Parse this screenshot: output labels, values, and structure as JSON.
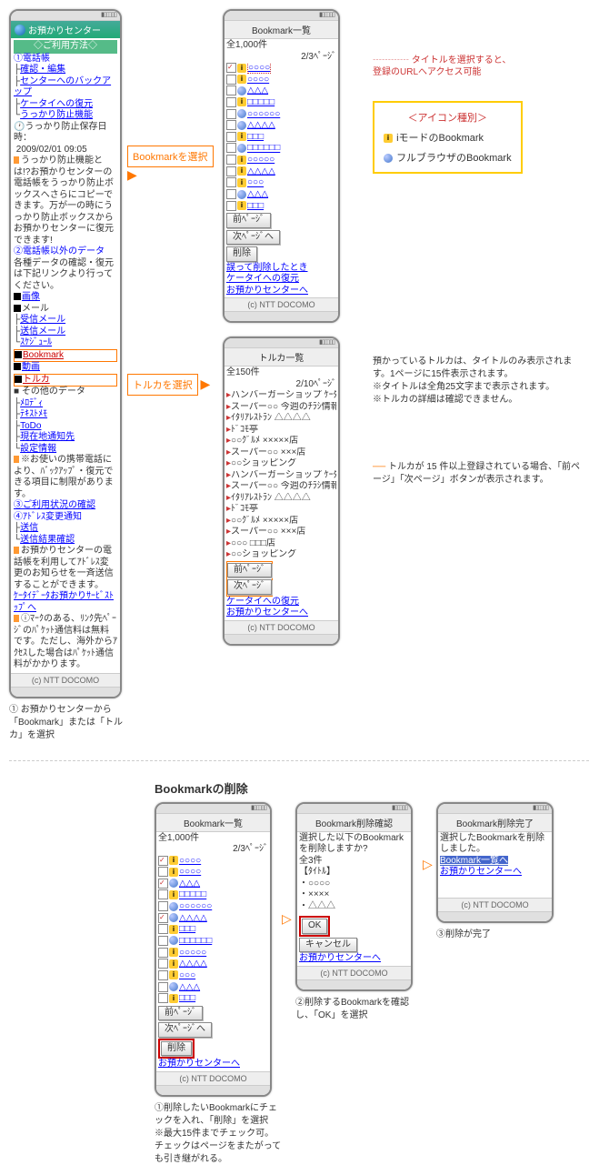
{
  "phone1": {
    "title": "お預かりセンター",
    "usage_header": "◇ご利用方法◇",
    "sec1_title": "①電話帳",
    "links1": [
      "確認・編集",
      "センターへのバックアップ",
      "ケータイへの復元",
      "うっかり防止機能"
    ],
    "clock_label": "うっかり防止保存日時：",
    "clock_time": "2009/02/01 09:05",
    "body1": "うっかり防止機能とは!?お預かりセンターの電話帳をうっかり防止ボックスへさらにコピーできます。万が一の時にうっかり防止ボックスからお預かりセンターに復元できます!",
    "sec2_title": "②電話帳以外のデータ",
    "body2": "各種データの確認・復元は下記リンクより行ってください。",
    "items2": [
      "画像",
      "メール",
      "受信メール",
      "送信メール",
      "ｽｹｼﾞｭｰﾙ",
      "Bookmark",
      "動画",
      "トルカ"
    ],
    "other_title": "■ その他のデータ",
    "items3": [
      "ﾒﾛﾃﾞｨ",
      "ﾃｷｽﾄﾒﾓ",
      "ToDo",
      "現在地通知先",
      "設定情報"
    ],
    "body3": "※お使いの携帯電話により、ﾊﾞｯｸｱｯﾌﾟ・復元できる項目に制限があります。",
    "sec3_title": "③ご利用状況の確認",
    "sec4_title": "④ｱﾄﾞﾚｽ変更通知",
    "links4": [
      "送信",
      "送信結果確認"
    ],
    "body4": "お預かりセンターの電話帳を利用してｱﾄﾞﾚｽ変更のお知らせを一斉送信することができます。",
    "link5": "ｹｰﾀｲﾃﾞｰﾀお預かりｻｰﾋﾞｽﾄｯﾌﾟへ",
    "body5": "ⓘﾏｰｸのある、ﾘﾝｸ先ﾍﾟｰｼﾞのﾊﾟｹｯﾄ通信料は無料です。ただし、海外からｱｸｾｽした場合はﾊﾟｹｯﾄ通信料がかかります。",
    "footer": "(c) NTT DOCOMO"
  },
  "cap1": "① お預かりセンターから「Bookmark」または「トルカ」を選択",
  "callout_bm": "Bookmarkを選択",
  "callout_tr": "トルカを選択",
  "phone2": {
    "title": "Bookmark一覧",
    "count": "全1,000件",
    "page": "2/3ﾍﾟｰｼﾞ",
    "items": [
      {
        "i": "i",
        "c": true,
        "t": "○○○○",
        "hl": true
      },
      {
        "i": "i",
        "t": "○○○○"
      },
      {
        "i": "g",
        "t": "△△△"
      },
      {
        "i": "i",
        "t": "□□□□□"
      },
      {
        "i": "g",
        "t": "○○○○○○"
      },
      {
        "i": "g",
        "t": "△△△△"
      },
      {
        "i": "i",
        "t": "□□□"
      },
      {
        "i": "g",
        "t": "□□□□□□"
      },
      {
        "i": "i",
        "t": "○○○○○"
      },
      {
        "i": "i",
        "t": "△△△△"
      },
      {
        "i": "i",
        "t": "○○○"
      },
      {
        "i": "g",
        "t": "△△△"
      },
      {
        "i": "i",
        "t": "□□□"
      }
    ],
    "prev": "前ﾍﾟｰｼﾞ",
    "next": "次ﾍﾟｰｼﾞへ",
    "del": "削除",
    "links": [
      "誤って削除したとき",
      "ケータイへの復元",
      "お預かりセンターへ"
    ],
    "footer": "(c) NTT DOCOMO"
  },
  "annot_bm1": "タイトルを選択すると、",
  "annot_bm2": "登録のURLへアクセス可能",
  "legend": {
    "title": "＜アイコン種別＞",
    "i1": "iモードのBookmark",
    "i2": "フルブラウザのBookmark"
  },
  "phone3": {
    "title": "トルカ一覧",
    "count": "全150件",
    "page": "2/10ﾍﾟｰｼﾞ",
    "items": [
      "ハンバーガーショップ ｹｰﾀｲｸｰﾎﾟﾝ",
      "スーパー○○ 今週のﾁﾗｼ情報",
      "ｲﾀﾘｱﾚｽﾄﾗﾝ △△△△",
      "ﾄﾞｺﾓ亭",
      "○○ｸﾞﾙﾒ ×××××店",
      "スーパー○○ ×××店",
      "○○ショッピング",
      "ハンバーガーショップ ｹｰﾀｲｸｰﾎﾟﾝ",
      "スーパー○○ 今週のﾁﾗｼ情報",
      "ｲﾀﾘｱﾚｽﾄﾗﾝ △△△△",
      "ﾄﾞｺﾓ亭",
      "○○ｸﾞﾙﾒ ×××××店",
      "スーパー○○ ×××店",
      "○○○ □□□店",
      "○○ショッピング"
    ],
    "prev": "前ﾍﾟｰｼﾞ",
    "next": "次ﾍﾟｰｼﾞ",
    "links": [
      "ケータイへの復元",
      "お預かりセンターへ"
    ],
    "footer": "(c) NTT DOCOMO"
  },
  "note_tr1": "預かっているトルカは、タイトルのみ表示されます。1ページに15件表示されます。",
  "note_tr2": "※タイトルは全角25文字まで表示されます。",
  "note_tr3": "※トルカの詳細は確認できません。",
  "note_tr4": "トルカが 15 件以上登録されている場合、「前ページ」「次ページ」ボタンが表示されます。",
  "section2_title": "Bookmarkの削除",
  "phone4": {
    "title": "Bookmark一覧",
    "count": "全1,000件",
    "page": "2/3ﾍﾟｰｼﾞ",
    "del": "削除",
    "link": "お預かりセンターへ",
    "footer": "(c) NTT DOCOMO"
  },
  "cap4a": "①削除したいBookmarkにチェックを入れ、「削除」を選択",
  "cap4b": "※最大15件までチェック可。チェックはページをまたがっても引き継がれる。",
  "phone5": {
    "title": "Bookmark削除確認",
    "msg": "選択した以下のBookmarkを削除しますか?",
    "count": "全3件",
    "label": "【ﾀｲﾄﾙ】",
    "items": [
      "・○○○○",
      "・××××",
      "・△△△"
    ],
    "ok": "OK",
    "cancel": "キャンセル",
    "link": "お預かりセンターへ",
    "footer": "(c) NTT DOCOMO"
  },
  "cap5": "②削除するBookmarkを確認し、「OK」を選択",
  "phone6": {
    "title": "Bookmark削除完了",
    "msg": "選択したBookmarkを削除しました。",
    "link1": "Bookmark一覧へ",
    "link2": "お預かりセンターへ",
    "footer": "(c) NTT DOCOMO"
  },
  "cap6": "③削除が完了"
}
